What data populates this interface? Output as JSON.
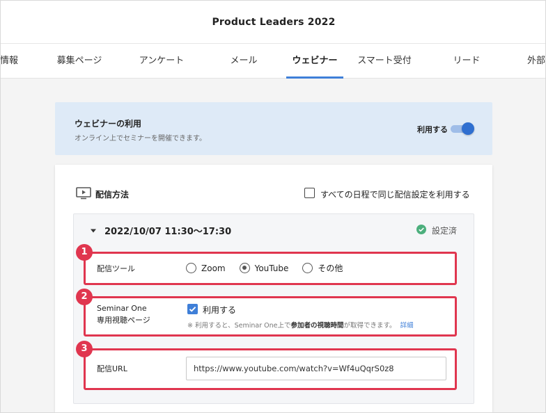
{
  "header": {
    "title": "Product Leaders 2022"
  },
  "tabs": [
    {
      "label": "情報"
    },
    {
      "label": "募集ページ"
    },
    {
      "label": "アンケート"
    },
    {
      "label": "メール"
    },
    {
      "label": "ウェビナー"
    },
    {
      "label": "スマート受付"
    },
    {
      "label": "リード"
    },
    {
      "label": "外部"
    }
  ],
  "webinar_banner": {
    "title": "ウェビナーの利用",
    "description": "オンライン上でセミナーを開催できます。",
    "toggle_label": "利用する",
    "toggle_on": true
  },
  "delivery": {
    "section_title": "配信方法",
    "sync_checkbox_label": "すべての日程で同じ配信設定を利用する",
    "schedule": {
      "date": "2022/10/07  11:30〜17:30",
      "status": "設定済"
    },
    "rows": [
      {
        "badge": "1",
        "label": "配信ツール",
        "options": [
          "Zoom",
          "YouTube",
          "その他"
        ],
        "selected": "YouTube"
      },
      {
        "badge": "2",
        "label_line1": "Seminar One",
        "label_line2": "専用視聴ページ",
        "checkbox_label": "利用する",
        "note_prefix": "※ 利用すると、Seminar One上で",
        "note_bold": "参加者の視聴時間",
        "note_suffix": "が取得できます。",
        "detail_link": "詳細"
      },
      {
        "badge": "3",
        "label": "配信URL",
        "url_value": "https://www.youtube.com/watch?v=Wf4uQqrS0z8"
      }
    ]
  },
  "colors": {
    "accent": "#3f7fd8",
    "highlight": "#e0364f",
    "banner_bg": "#deeaf7",
    "status_ok": "#4caf7d"
  }
}
